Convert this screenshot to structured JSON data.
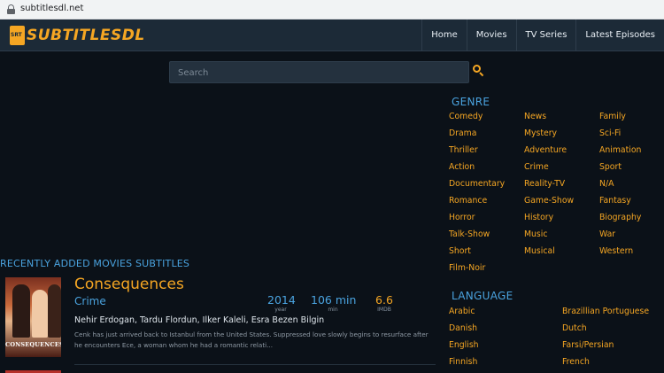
{
  "browser": {
    "url": "subtitlesdl.net"
  },
  "header": {
    "logo_badge": "SRT",
    "logo_text": "SUBTITLESDL",
    "nav": [
      "Home",
      "Movies",
      "TV Series",
      "Latest Episodes"
    ]
  },
  "search": {
    "placeholder": "Search"
  },
  "sidebar": {
    "genre_heading": "GENRE",
    "genres": [
      "Comedy",
      "News",
      "Family",
      "Drama",
      "Mystery",
      "Sci-Fi",
      "Thriller",
      "Adventure",
      "Animation",
      "Action",
      "Crime",
      "Sport",
      "Documentary",
      "Reality-TV",
      "N/A",
      "Romance",
      "Game-Show",
      "Fantasy",
      "Horror",
      "History",
      "Biography",
      "Talk-Show",
      "Music",
      "War",
      "Short",
      "Musical",
      "Western",
      "Film-Noir"
    ],
    "language_heading": "LANGUAGE",
    "languages": [
      "Arabic",
      "Brazillian Portuguese",
      "Danish",
      "Dutch",
      "English",
      "Farsi/Persian",
      "Finnish",
      "French"
    ]
  },
  "recent": {
    "heading": "RECENTLY ADDED MOVIES SUBTITLES",
    "movies": [
      {
        "poster_text": "CONSEQUENCES",
        "title": "Consequences",
        "genre": "Crime",
        "year": "2014",
        "year_label": "year",
        "runtime": "106 min",
        "runtime_label": "min",
        "rating": "6.6",
        "rating_label": "IMDB",
        "cast": "Nehir Erdogan, Tardu Flordun, Ilker Kaleli, Esra Bezen Bilgin",
        "description": "Cenk has just arrived back to Istanbul from the United States. Suppressed love slowly begins to resurface after he encounters Ece, a woman whom he had a romantic relati..."
      }
    ]
  },
  "colors": {
    "accent": "#f5a623",
    "link_blue": "#4aa3df",
    "background": "#0b1118",
    "header_bg": "#1c2a37"
  }
}
